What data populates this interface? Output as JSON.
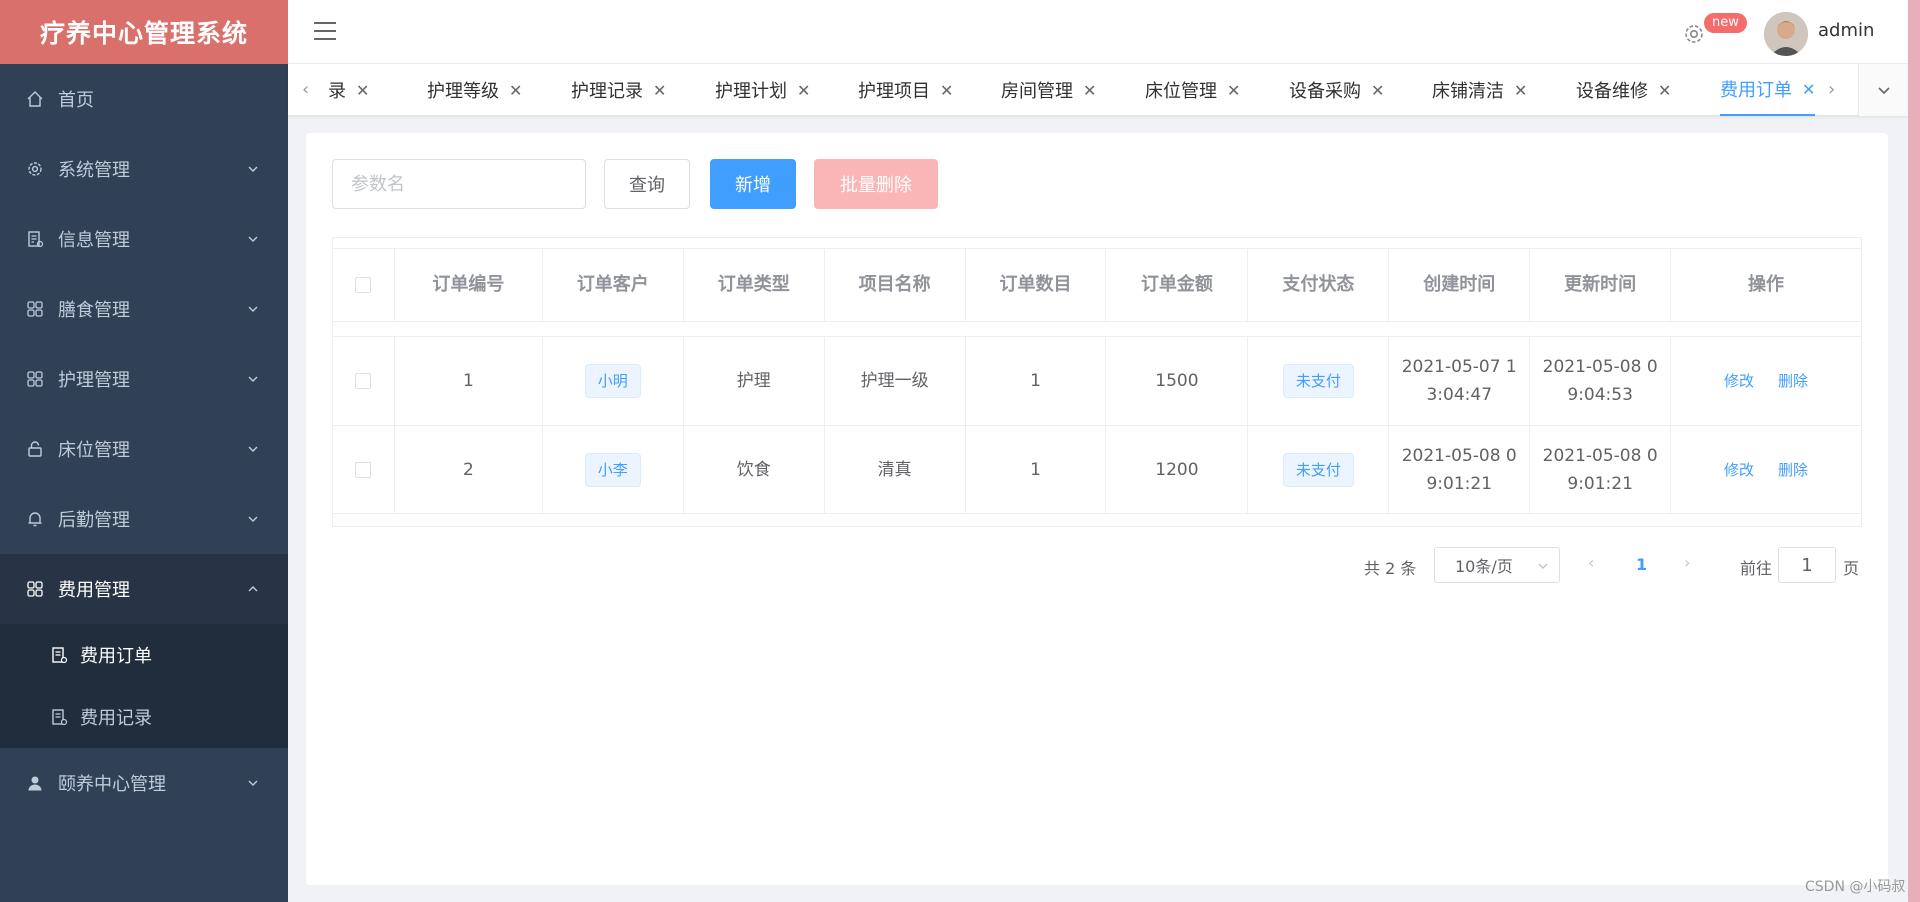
{
  "app": {
    "title": "疗养中心管理系统"
  },
  "sidebar": {
    "items": [
      {
        "label": "首页",
        "icon": "home-icon"
      },
      {
        "label": "系统管理",
        "icon": "gear-icon"
      },
      {
        "label": "信息管理",
        "icon": "document-icon"
      },
      {
        "label": "膳食管理",
        "icon": "grid-icon"
      },
      {
        "label": "护理管理",
        "icon": "grid-icon"
      },
      {
        "label": "床位管理",
        "icon": "lock-icon"
      },
      {
        "label": "后勤管理",
        "icon": "bell-icon"
      },
      {
        "label": "费用管理",
        "icon": "grid-icon"
      },
      {
        "label": "颐养中心管理",
        "icon": "user-icon"
      }
    ],
    "sub_items": [
      {
        "label": "费用订单",
        "icon": "document-gear-icon"
      },
      {
        "label": "费用记录",
        "icon": "document-gear-icon"
      }
    ]
  },
  "header": {
    "badge": "new",
    "username": "admin"
  },
  "tags": [
    {
      "label": "录",
      "active": false
    },
    {
      "label": "护理等级",
      "active": false
    },
    {
      "label": "护理记录",
      "active": false
    },
    {
      "label": "护理计划",
      "active": false
    },
    {
      "label": "护理项目",
      "active": false
    },
    {
      "label": "房间管理",
      "active": false
    },
    {
      "label": "床位管理",
      "active": false
    },
    {
      "label": "设备采购",
      "active": false
    },
    {
      "label": "床铺清洁",
      "active": false
    },
    {
      "label": "设备维修",
      "active": false
    },
    {
      "label": "费用订单",
      "active": true
    }
  ],
  "toolbar": {
    "search_placeholder": "参数名",
    "query_label": "查询",
    "add_label": "新增",
    "batch_delete_label": "批量删除"
  },
  "table": {
    "columns": [
      "订单编号",
      "订单客户",
      "订单类型",
      "项目名称",
      "订单数目",
      "订单金额",
      "支付状态",
      "创建时间",
      "更新时间",
      "操作"
    ],
    "rows": [
      {
        "id": "1",
        "customer": "小明",
        "type": "护理",
        "project": "护理一级",
        "count": "1",
        "amount": "1500",
        "status": "未支付",
        "created": "2021-05-07 13:04:47",
        "updated": "2021-05-08 09:04:53"
      },
      {
        "id": "2",
        "customer": "小李",
        "type": "饮食",
        "project": "清真",
        "count": "1",
        "amount": "1200",
        "status": "未支付",
        "created": "2021-05-08 09:01:21",
        "updated": "2021-05-08 09:01:21"
      }
    ],
    "edit_label": "修改",
    "delete_label": "删除"
  },
  "pagination": {
    "total": "共 2 条",
    "page_size": "10条/页",
    "current_page": "1",
    "goto_prefix": "前往",
    "goto_value": "1",
    "goto_suffix": "页"
  },
  "watermark": "CSDN @小码叔",
  "colors": {
    "primary": "#409eff",
    "sidebar": "#304156",
    "logo": "#d9706b",
    "danger": "#f56c6c"
  }
}
